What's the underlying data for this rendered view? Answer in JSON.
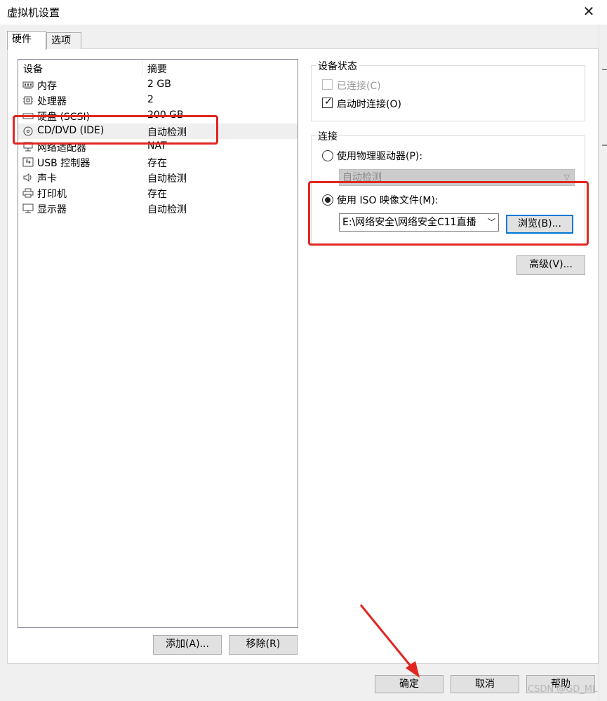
{
  "window": {
    "title": "虚拟机设置",
    "close_glyph": "✕"
  },
  "tabs": [
    {
      "label": "硬件",
      "active": true
    },
    {
      "label": "选项",
      "active": false
    }
  ],
  "device_list": {
    "headers": {
      "device": "设备",
      "summary": "摘要"
    },
    "rows": [
      {
        "icon": "memory-icon",
        "name": "内存",
        "summary": "2 GB"
      },
      {
        "icon": "processor-icon",
        "name": "处理器",
        "summary": "2"
      },
      {
        "icon": "harddisk-icon",
        "name": "硬盘 (SCSI)",
        "summary": "200 GB"
      },
      {
        "icon": "cd-dvd-icon",
        "name": "CD/DVD (IDE)",
        "summary": "自动检测",
        "selected": true
      },
      {
        "icon": "network-adapter-icon",
        "name": "网络适配器",
        "summary": "NAT"
      },
      {
        "icon": "usb-icon",
        "name": "USB 控制器",
        "summary": "存在"
      },
      {
        "icon": "sound-card-icon",
        "name": "声卡",
        "summary": "自动检测"
      },
      {
        "icon": "printer-icon",
        "name": "打印机",
        "summary": "存在"
      },
      {
        "icon": "display-icon",
        "name": "显示器",
        "summary": "自动检测"
      }
    ]
  },
  "list_buttons": {
    "add": "添加(A)...",
    "remove": "移除(R)"
  },
  "device_status": {
    "title": "设备状态",
    "connected": {
      "label": "已连接(C)",
      "checked": false,
      "enabled": false
    },
    "connect_at_power_on": {
      "label": "启动时连接(O)",
      "checked": true
    }
  },
  "connection": {
    "title": "连接",
    "physical_drive": {
      "label": "使用物理驱动器(P):",
      "selected": false,
      "dropdown_value": "自动检测"
    },
    "iso_image": {
      "label": "使用 ISO 映像文件(M):",
      "selected": true,
      "path_value": "E:\\网络安全\\网络安全C11直播"
    },
    "browse_button": "浏览(B)...",
    "advanced_button": "高级(V)..."
  },
  "footer_buttons": {
    "ok": "确定",
    "cancel": "取消",
    "help": "帮助"
  },
  "watermark": "CSDN @GD_ML",
  "colors": {
    "highlight": "#e0261f",
    "focus": "#0078d7",
    "selected_row": "#efefef"
  }
}
